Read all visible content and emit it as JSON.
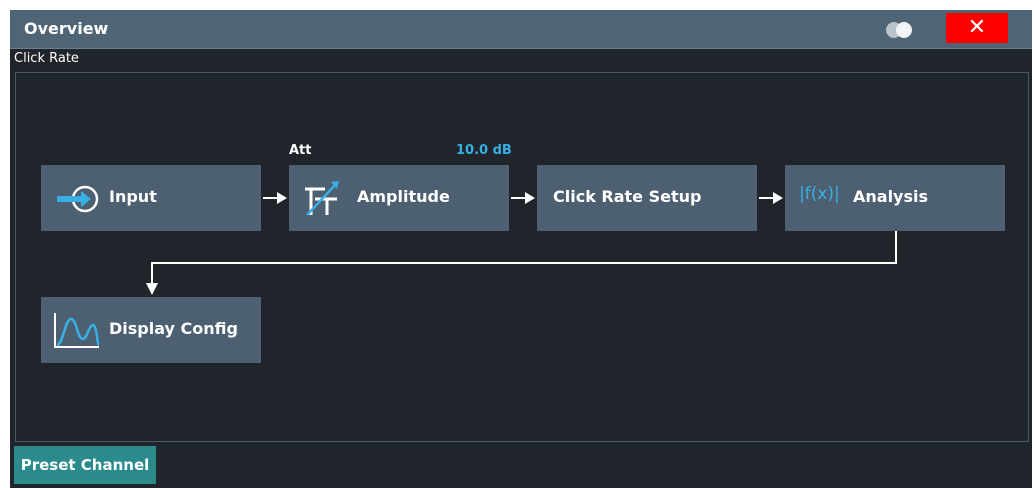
{
  "window": {
    "title": "Overview",
    "close_label": "✕"
  },
  "subtitle": "Click Rate",
  "attenuation": {
    "label": "Att",
    "value": "10.0 dB"
  },
  "blocks": {
    "input": "Input",
    "amplitude": "Amplitude",
    "click_rate_setup": "Click Rate Setup",
    "analysis": "Analysis",
    "display_config": "Display Config"
  },
  "icon_labels": {
    "analysis": "|f(x)|"
  },
  "footer": {
    "preset_label": "Preset Channel"
  },
  "colors": {
    "background": "#1f252b",
    "block": "#4c6071",
    "titlebar": "#4f6575",
    "accent": "#38b0e6",
    "close": "#ff0000",
    "preset": "#2a8a8c"
  }
}
